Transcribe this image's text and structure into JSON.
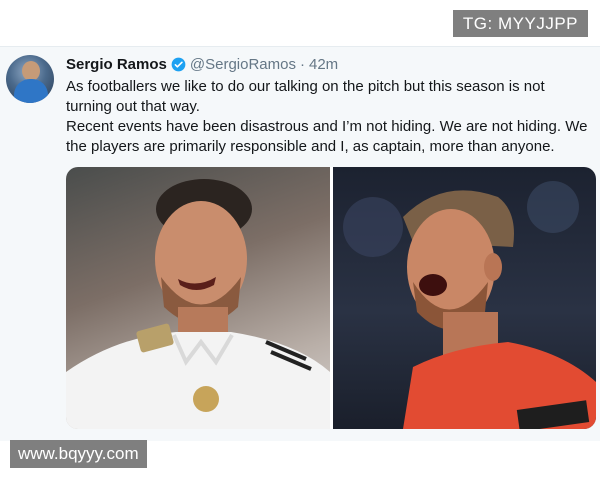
{
  "watermarks": {
    "top": "TG: MYYJJPP",
    "bottom": "www.bqyyy.com"
  },
  "tweet": {
    "display_name": "Sergio Ramos",
    "handle": "@SergioRamos",
    "separator": "·",
    "timestamp": "42m",
    "verified": true,
    "lines": [
      "As footballers we like to do our talking on the pitch but this season is not turning out that way.",
      "Recent events have been disastrous and I’m not hiding. We are not hiding. We the players are primarily responsible and I, as captain, more than anyone."
    ],
    "media": [
      {
        "description_icon": "player-photo-white-kit"
      },
      {
        "description_icon": "player-photo-red-kit"
      }
    ]
  },
  "colors": {
    "verified_blue": "#1da1f2",
    "text_primary": "#14171a",
    "text_secondary": "#657786",
    "tweet_background": "#f5f8fa",
    "watermark_bg": "#7f7f7f"
  }
}
